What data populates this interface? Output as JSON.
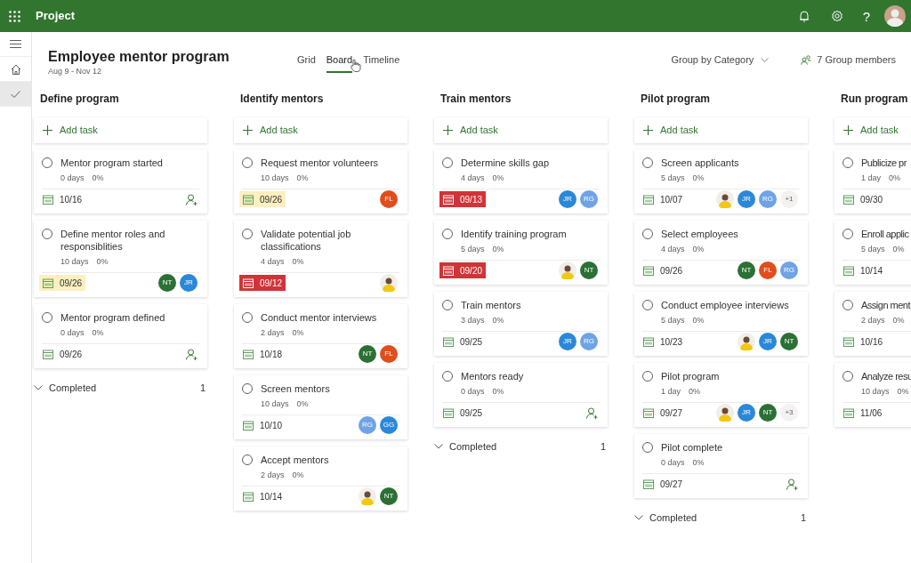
{
  "app": {
    "name": "Project",
    "help": "?"
  },
  "rail": [
    {
      "kind": "menu",
      "selected": false
    },
    {
      "kind": "home",
      "selected": false
    },
    {
      "kind": "check",
      "selected": true
    }
  ],
  "plan": {
    "title": "Employee mentor program",
    "dates": "Aug 9 - Nov 12"
  },
  "views": [
    {
      "label": "Grid",
      "selected": false
    },
    {
      "label": "Board",
      "selected": true
    },
    {
      "label": "Timeline",
      "selected": false
    }
  ],
  "group_by": "Group by Category",
  "members": "7 Group members",
  "columns": [
    {
      "name": "Define program",
      "add": "Add task",
      "tasks": [
        {
          "title": "Mentor program started",
          "done": false,
          "duration": "0 days",
          "progress": "0%",
          "due": "10/16",
          "due_soon": false,
          "overdue": false
        },
        {
          "title": "Define mentor roles and responsiblities",
          "done": false,
          "duration": "10 days",
          "progress": "0%",
          "due": "09/26",
          "due_soon": true,
          "overdue": false,
          "assignees": [
            {
              "kind": "initials",
              "text": "NT",
              "color": "#2b7034"
            },
            {
              "kind": "initials",
              "text": "JR",
              "color": "#2b88d8"
            }
          ]
        },
        {
          "title": "Mentor program defined",
          "done": false,
          "duration": "0 days",
          "progress": "0%",
          "due": "09/26",
          "due_soon": false,
          "overdue": false
        }
      ],
      "completed": {
        "label": "Completed",
        "count": "1"
      }
    },
    {
      "name": "Identify mentors",
      "add": "Add task",
      "tasks": [
        {
          "title": "Request mentor volunteers",
          "done": false,
          "duration": "10 days",
          "progress": "0%",
          "due": "09/26",
          "due_soon": true,
          "overdue": false,
          "assignees": [
            {
              "kind": "initials",
              "text": "FL",
              "color": "#e04e1b"
            }
          ]
        },
        {
          "title": "Validate potential job classifications",
          "done": false,
          "duration": "4 days",
          "progress": "0%",
          "due": "09/12",
          "due_soon": false,
          "overdue": true,
          "assignees": [
            {
              "kind": "photo"
            }
          ]
        },
        {
          "title": "Conduct mentor interviews",
          "done": false,
          "duration": "2 days",
          "progress": "0%",
          "due": "10/18",
          "due_soon": false,
          "overdue": false,
          "assignees": [
            {
              "kind": "initials",
              "text": "NT",
              "color": "#2b7034"
            },
            {
              "kind": "initials",
              "text": "FL",
              "color": "#e04e1b"
            }
          ]
        },
        {
          "title": "Screen mentors",
          "done": false,
          "duration": "10 days",
          "progress": "0%",
          "due": "10/10",
          "due_soon": false,
          "overdue": false,
          "assignees": [
            {
              "kind": "initials",
              "text": "RG",
              "color": "#6fa3e6"
            },
            {
              "kind": "initials",
              "text": "GG",
              "color": "#2b88d8"
            }
          ]
        },
        {
          "title": "Accept mentors",
          "done": false,
          "duration": "2 days",
          "progress": "0%",
          "due": "10/14",
          "due_soon": false,
          "overdue": false,
          "assignees": [
            {
              "kind": "photo"
            },
            {
              "kind": "initials",
              "text": "NT",
              "color": "#2b7034"
            }
          ]
        }
      ]
    },
    {
      "name": "Train mentors",
      "add": "Add task",
      "tasks": [
        {
          "title": "Determine skills gap",
          "done": false,
          "duration": "4 days",
          "progress": "0%",
          "due": "09/13",
          "due_soon": false,
          "overdue": true,
          "assignees": [
            {
              "kind": "initials",
              "text": "JR",
              "color": "#2b88d8"
            },
            {
              "kind": "initials",
              "text": "RG",
              "color": "#6fa3e6"
            }
          ]
        },
        {
          "title": "Identify training program",
          "done": false,
          "duration": "5 days",
          "progress": "0%",
          "due": "09/20",
          "due_soon": false,
          "overdue": true,
          "assignees": [
            {
              "kind": "photo"
            },
            {
              "kind": "initials",
              "text": "NT",
              "color": "#2b7034"
            }
          ]
        },
        {
          "title": "Train mentors",
          "done": false,
          "duration": "3 days",
          "progress": "0%",
          "due": "09/25",
          "due_soon": false,
          "overdue": false,
          "assignees": [
            {
              "kind": "initials",
              "text": "JR",
              "color": "#2b88d8"
            },
            {
              "kind": "initials",
              "text": "RG",
              "color": "#6fa3e6"
            }
          ]
        },
        {
          "title": "Mentors ready",
          "done": false,
          "duration": "0 days",
          "progress": "0%",
          "due": "09/25",
          "due_soon": false,
          "overdue": false
        }
      ],
      "completed": {
        "label": "Completed",
        "count": "1"
      }
    },
    {
      "name": "Pilot program",
      "add": "Add task",
      "tasks": [
        {
          "title": "Screen applicants",
          "done": false,
          "duration": "5 days",
          "progress": "0%",
          "due": "10/07",
          "due_soon": false,
          "overdue": false,
          "assignees": [
            {
              "kind": "photo"
            },
            {
              "kind": "initials",
              "text": "JR",
              "color": "#2b88d8"
            },
            {
              "kind": "initials",
              "text": "RG",
              "color": "#6fa3e6"
            },
            {
              "kind": "more",
              "text": "+1"
            }
          ]
        },
        {
          "title": "Select employees",
          "done": false,
          "duration": "4 days",
          "progress": "0%",
          "due": "09/26",
          "due_soon": false,
          "overdue": false,
          "assignees": [
            {
              "kind": "initials",
              "text": "NT",
              "color": "#2b7034"
            },
            {
              "kind": "initials",
              "text": "FL",
              "color": "#e04e1b"
            },
            {
              "kind": "initials",
              "text": "RG",
              "color": "#6fa3e6"
            }
          ]
        },
        {
          "title": "Conduct employee interviews",
          "done": false,
          "duration": "5 days",
          "progress": "0%",
          "due": "10/23",
          "due_soon": false,
          "overdue": false,
          "assignees": [
            {
              "kind": "photo"
            },
            {
              "kind": "initials",
              "text": "JR",
              "color": "#2b88d8"
            },
            {
              "kind": "initials",
              "text": "NT",
              "color": "#2b7034"
            }
          ]
        },
        {
          "title": "Pilot program",
          "done": false,
          "duration": "1 day",
          "progress": "0%",
          "due": "09/27",
          "due_soon": false,
          "overdue": false,
          "assignees": [
            {
              "kind": "photo"
            },
            {
              "kind": "initials",
              "text": "JR",
              "color": "#2b88d8"
            },
            {
              "kind": "initials",
              "text": "NT",
              "color": "#2b7034"
            },
            {
              "kind": "more",
              "text": "+3"
            }
          ]
        },
        {
          "title": "Pilot complete",
          "done": false,
          "duration": "0 days",
          "progress": "0%",
          "due": "09/27",
          "due_soon": false,
          "overdue": false
        }
      ],
      "completed": {
        "label": "Completed",
        "count": "1"
      }
    },
    {
      "name": "Run program",
      "add": "Add task",
      "tasks": [
        {
          "title": "Publicize pr",
          "done": false,
          "duration": "1 day",
          "progress": "0%",
          "due": "09/30",
          "due_soon": false,
          "overdue": false
        },
        {
          "title": "Enroll applic",
          "done": false,
          "duration": "5 days",
          "progress": "0%",
          "due": "10/14",
          "due_soon": false,
          "overdue": false
        },
        {
          "title": "Assign ment",
          "done": false,
          "duration": "2 days",
          "progress": "0%",
          "due": "10/16",
          "due_soon": false,
          "overdue": false
        },
        {
          "title": "Analyze resu",
          "done": false,
          "duration": "10 days",
          "progress": "0%",
          "due": "11/06",
          "due_soon": false,
          "overdue": false
        }
      ]
    }
  ]
}
